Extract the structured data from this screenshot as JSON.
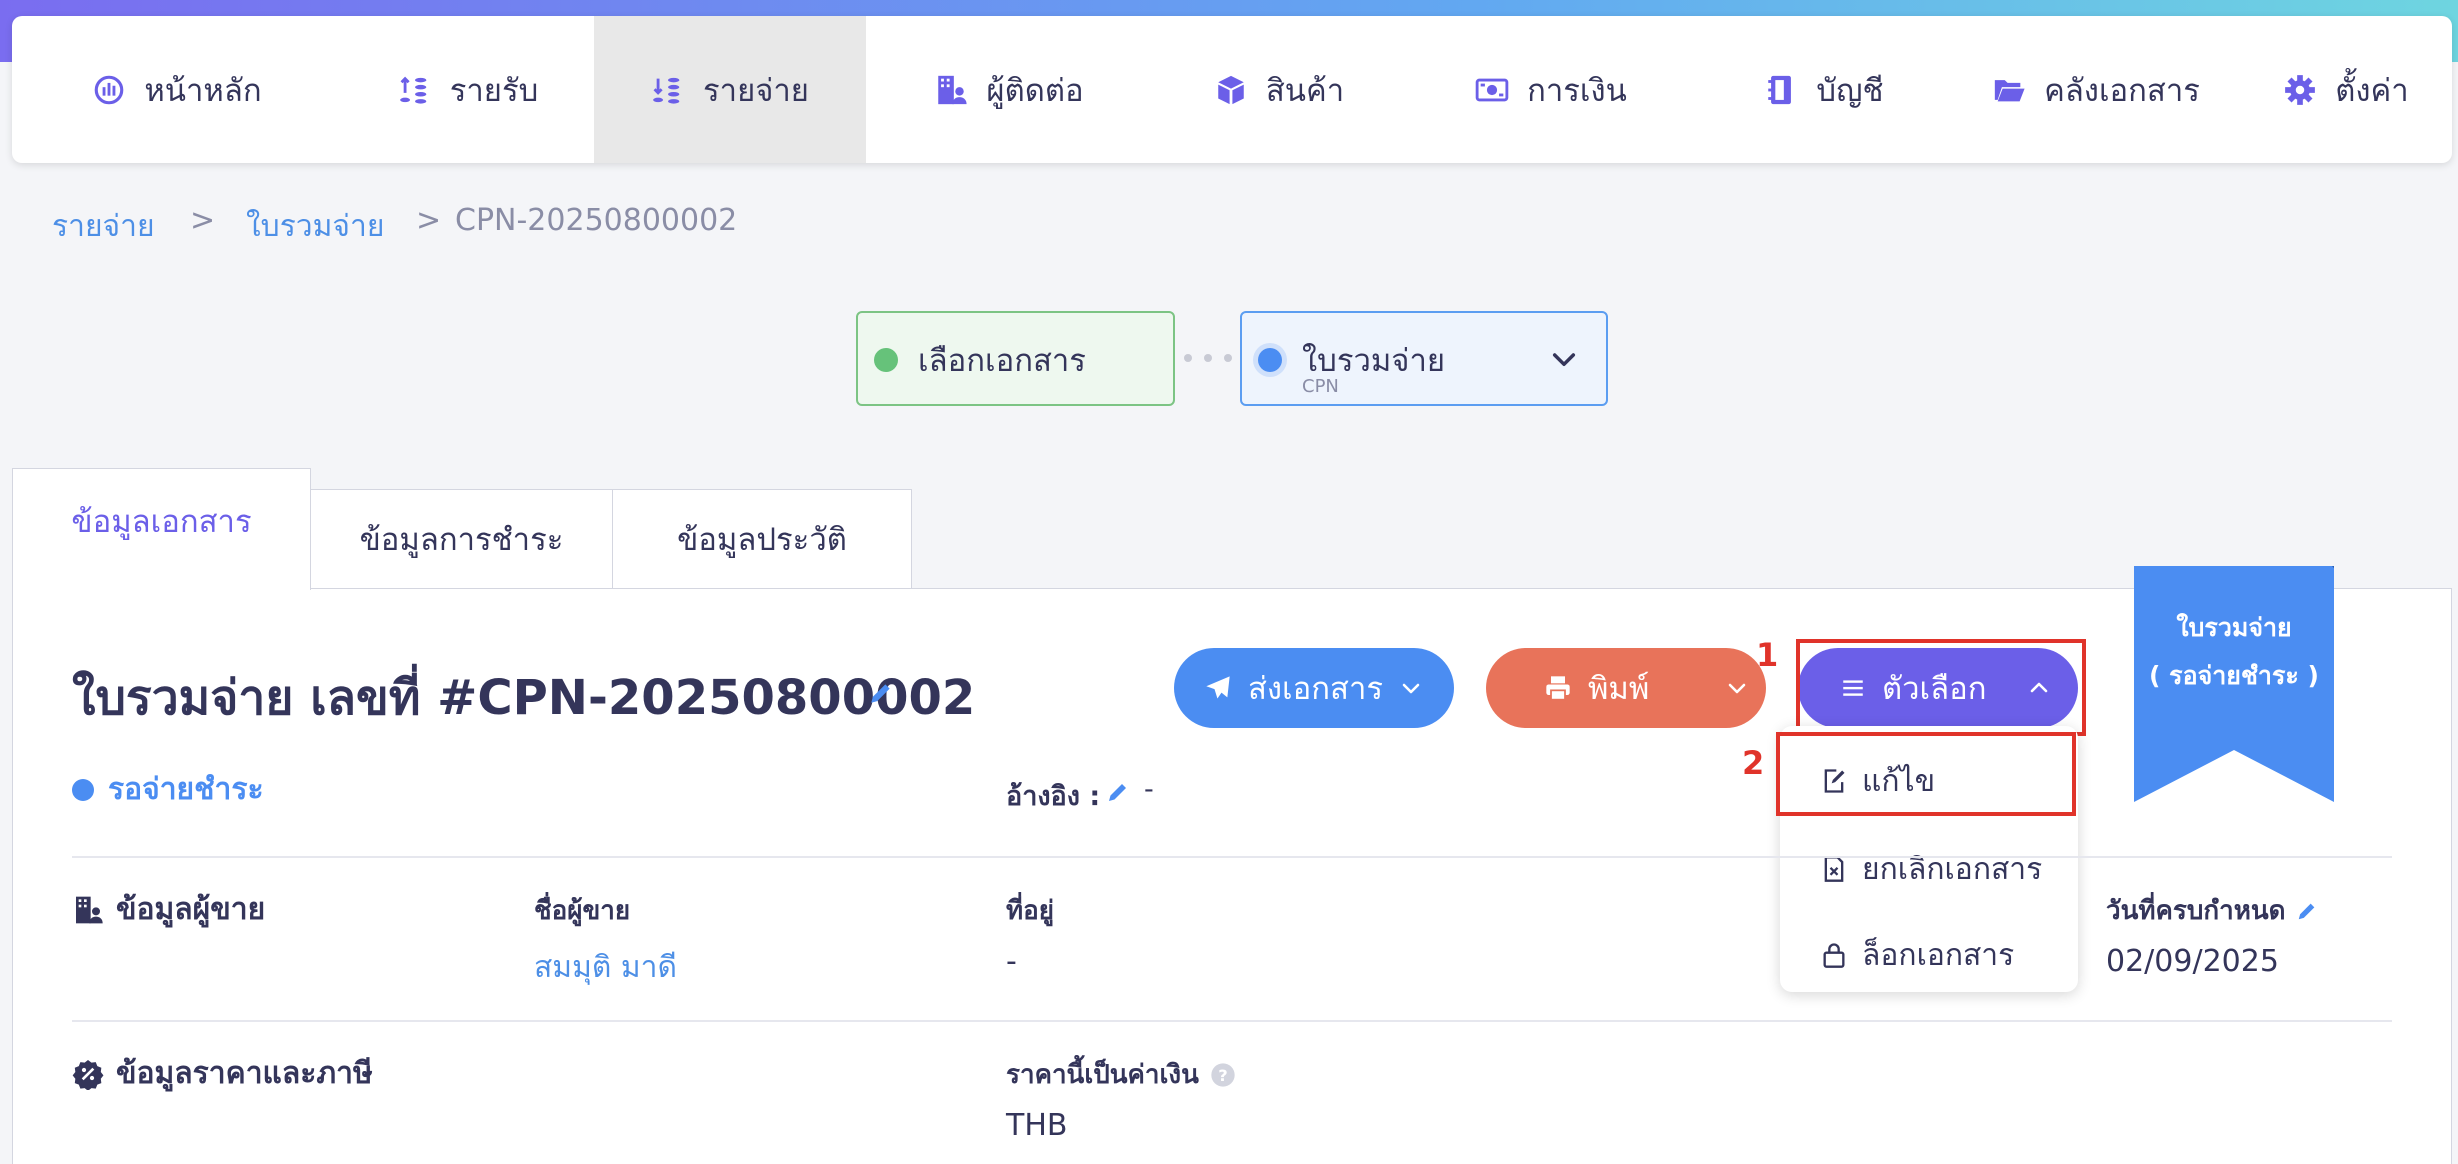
{
  "colors": {
    "primary": "#6b5fe8",
    "blue": "#4b8df2",
    "print": "#e8735a",
    "annotation": "#e0332a",
    "ribbon": "#4b8df2"
  },
  "nav": [
    {
      "label": "หน้าหลัก",
      "icon": "dashboard-icon"
    },
    {
      "label": "รายรับ",
      "icon": "income-icon"
    },
    {
      "label": "รายจ่าย",
      "icon": "expense-icon",
      "active": true
    },
    {
      "label": "ผู้ติดต่อ",
      "icon": "contacts-icon"
    },
    {
      "label": "สินค้า",
      "icon": "product-box-icon"
    },
    {
      "label": "การเงิน",
      "icon": "money-icon"
    },
    {
      "label": "บัญชี",
      "icon": "ledger-book-icon"
    },
    {
      "label": "คลังเอกสาร",
      "icon": "folder-icon"
    },
    {
      "label": "ตั้งค่า",
      "icon": "gear-icon"
    }
  ],
  "breadcrumb": {
    "items": [
      "รายจ่าย",
      "ใบรวมจ่าย"
    ],
    "separator": ">",
    "current": "CPN-20250800002"
  },
  "steps": [
    {
      "label": "เลือกเอกสาร"
    },
    {
      "label": "ใบรวมจ่าย",
      "sub": "CPN"
    }
  ],
  "tabs": [
    "ข้อมูลเอกสาร",
    "ข้อมูลการชำระ",
    "ข้อมูลประวัติ"
  ],
  "document": {
    "title": "ใบรวมจ่าย เลขที่ #CPN-20250800002",
    "status": "รอจ่ายชำระ",
    "reference_label": "อ้างอิง :",
    "reference_value": "-"
  },
  "actions": {
    "send": "ส่งเอกสาร",
    "print": "พิมพ์",
    "options": "ตัวเลือก"
  },
  "options_menu": [
    {
      "label": "แก้ไข",
      "icon": "edit-document-icon"
    },
    {
      "label": "ยกเลิกเอกสาร",
      "icon": "cancel-document-icon"
    },
    {
      "label": "ล็อกเอกสาร",
      "icon": "lock-icon"
    }
  ],
  "annotations": {
    "first": "1",
    "second": "2"
  },
  "ribbon": {
    "line1": "ใบรวมจ่าย",
    "line2": "( รอจ่ายชำระ )"
  },
  "seller": {
    "section": "ข้อมูลผู้ขาย",
    "name_label": "ชื่อผู้ขาย",
    "name_value": "สมมุติ มาดี",
    "address_label": "ที่อยู่",
    "address_value": "-",
    "due_label": "วันที่ครบกำหนด",
    "due_value": "02/09/2025"
  },
  "pricing": {
    "section": "ข้อมูลราคาและภาษี",
    "currency_label": "ราคานี้เป็นค่าเงิน",
    "currency_value": "THB"
  }
}
